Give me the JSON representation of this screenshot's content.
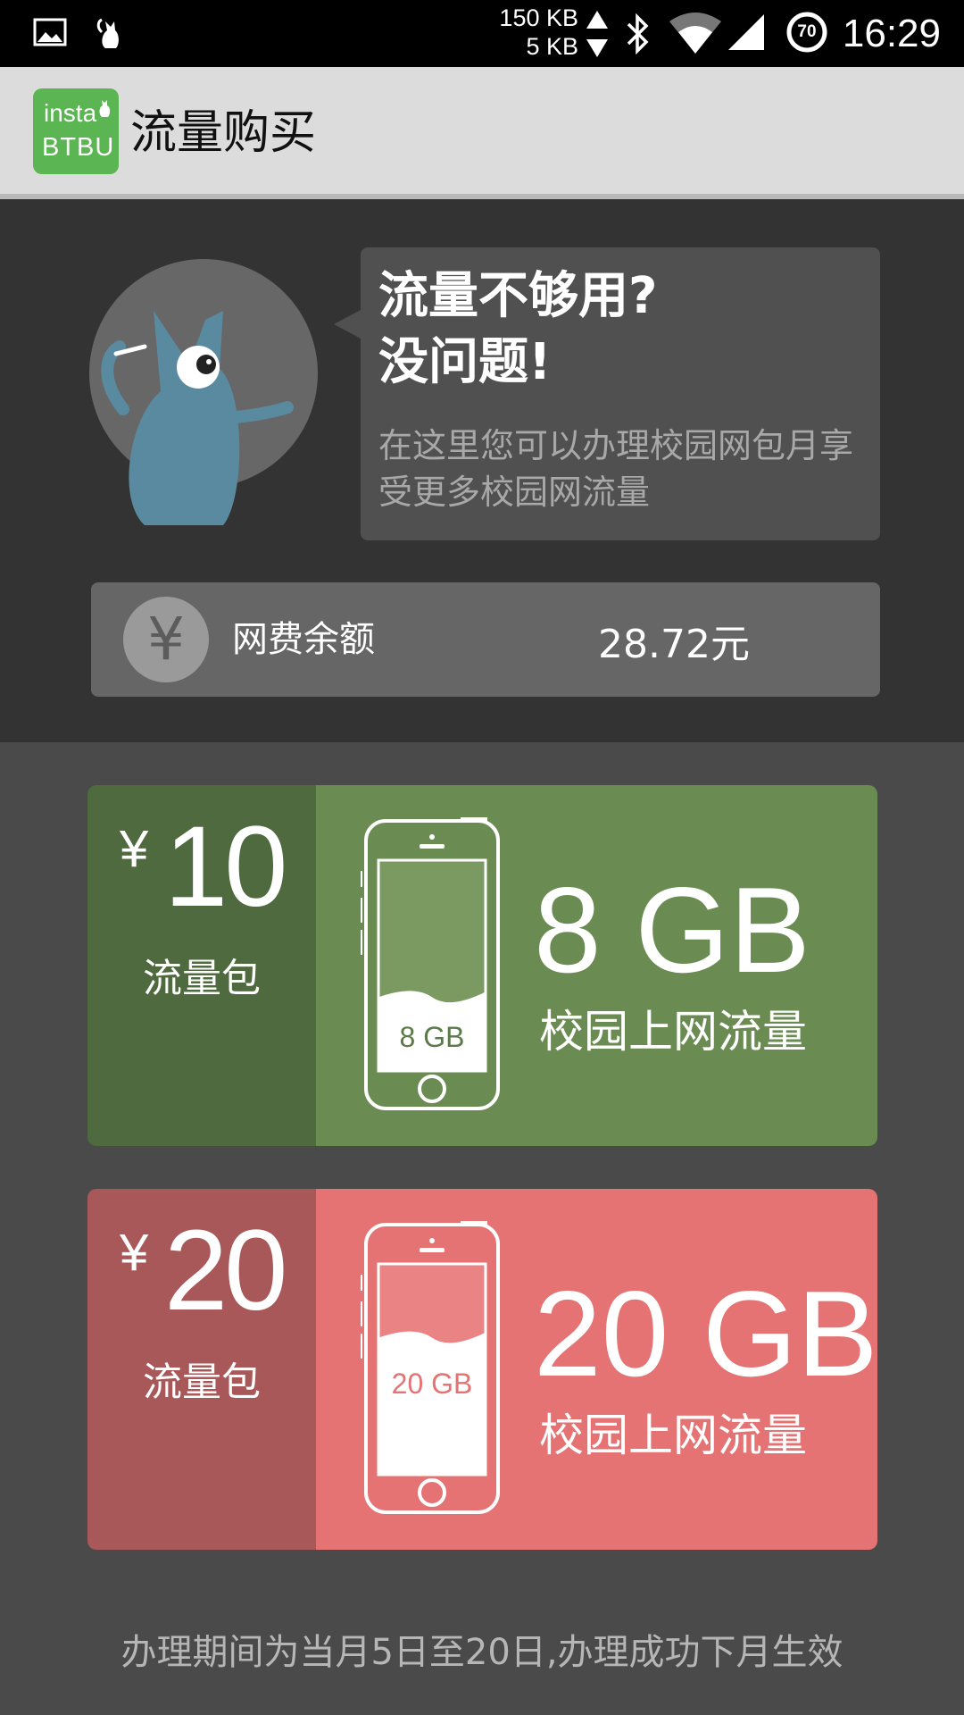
{
  "status_bar": {
    "upload_speed": "150 KB",
    "download_speed": "5 KB",
    "battery_level": "70",
    "time": "16:29",
    "icons": [
      "image-icon",
      "cat-icon",
      "bluetooth-icon",
      "wifi-icon",
      "signal-icon",
      "battery-icon"
    ]
  },
  "action_bar": {
    "logo_line1": "insta",
    "logo_line2": "BTBU",
    "title": "流量购买"
  },
  "promo": {
    "title_line1": "流量不够用?",
    "title_line2": "没问题!",
    "description": "在这里您可以办理校园网包月享受更多校园网流量"
  },
  "balance": {
    "currency_symbol": "¥",
    "label": "网费余额",
    "value": "28.72元"
  },
  "packages": [
    {
      "currency": "¥",
      "price": "10",
      "label": "流量包",
      "phone_label": "8 GB",
      "size": "8 GB",
      "description": "校园上网流量",
      "left_color": "#4f6a3e",
      "right_color": "#6a8b52",
      "screen_color": "#7a9a62",
      "fill_level": 0.35
    },
    {
      "currency": "¥",
      "price": "20",
      "label": "流量包",
      "phone_label": "20 GB",
      "size": "20 GB",
      "description": "校园上网流量",
      "left_color": "#a85858",
      "right_color": "#e57373",
      "screen_color": "#ea8484",
      "fill_level": 0.65
    }
  ],
  "footer": {
    "note": "办理期间为当月5日至20日,办理成功下月生效"
  }
}
